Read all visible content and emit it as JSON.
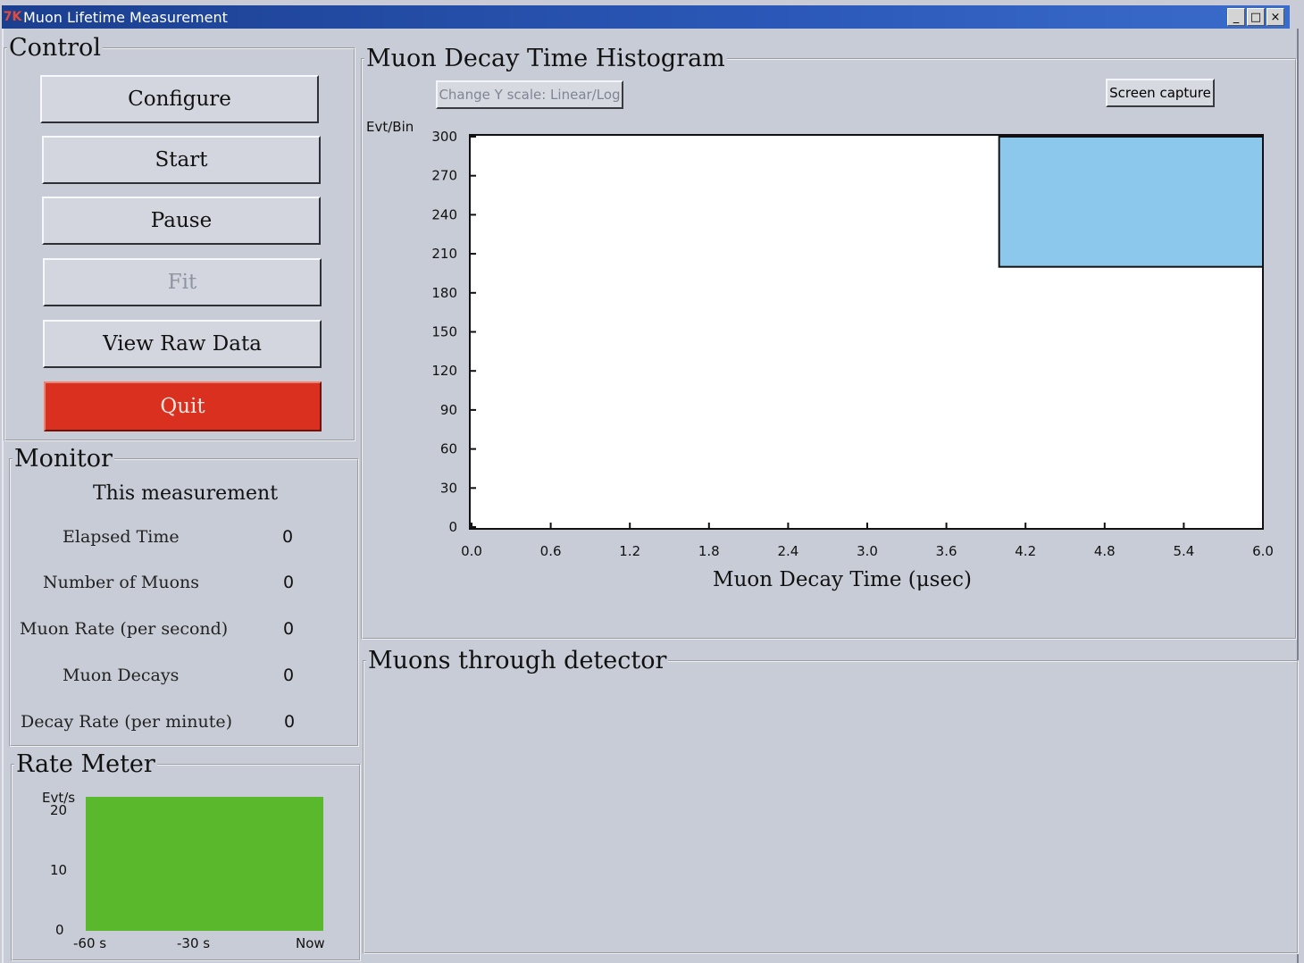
{
  "window": {
    "title": "Muon Lifetime Measurement",
    "icon": "app-icon",
    "controls": [
      "_",
      "□",
      "×"
    ]
  },
  "control": {
    "legend": "Control",
    "buttons": {
      "configure": "Configure",
      "start": "Start",
      "pause": "Pause",
      "fit": "Fit",
      "view_raw": "View Raw Data",
      "quit": "Quit"
    }
  },
  "monitor": {
    "legend": "Monitor",
    "heading": "This measurement",
    "rows": [
      {
        "label": "Elapsed Time",
        "value": "0"
      },
      {
        "label": "Number of Muons",
        "value": "0"
      },
      {
        "label": "Muon Rate (per second)",
        "value": "0"
      },
      {
        "label": "Muon Decays",
        "value": "0"
      },
      {
        "label": "Decay Rate (per minute)",
        "value": "0"
      }
    ]
  },
  "rate_meter": {
    "legend": "Rate Meter",
    "ylabel": "Evt/s",
    "yticks": [
      "20",
      "10",
      "0"
    ],
    "xticks": [
      "-60 s",
      "-30 s",
      "Now"
    ],
    "fill_color": "#5ab82d"
  },
  "histogram": {
    "legend": "Muon Decay Time Histogram",
    "scale_button": "Change Y scale: Linear/Log",
    "capture_button": "Screen capture"
  },
  "detector": {
    "legend": "Muons through detector"
  },
  "chart_data": {
    "type": "bar",
    "title": "",
    "xlabel": "Muon Decay Time (μsec)",
    "ylabel": "Evt/Bin",
    "xlim": [
      0.0,
      6.0
    ],
    "ylim": [
      0,
      300
    ],
    "xticks": [
      "0.0",
      "0.6",
      "1.2",
      "1.8",
      "2.4",
      "3.0",
      "3.6",
      "4.2",
      "4.8",
      "5.4",
      "6.0"
    ],
    "yticks": [
      "0",
      "30",
      "60",
      "90",
      "120",
      "150",
      "180",
      "210",
      "240",
      "270",
      "300"
    ],
    "bars": [
      {
        "x_start": 4.0,
        "x_end": 6.0,
        "y_bottom": 200,
        "y_top": 300,
        "color": "#8cc8ec"
      }
    ],
    "grid": false
  }
}
